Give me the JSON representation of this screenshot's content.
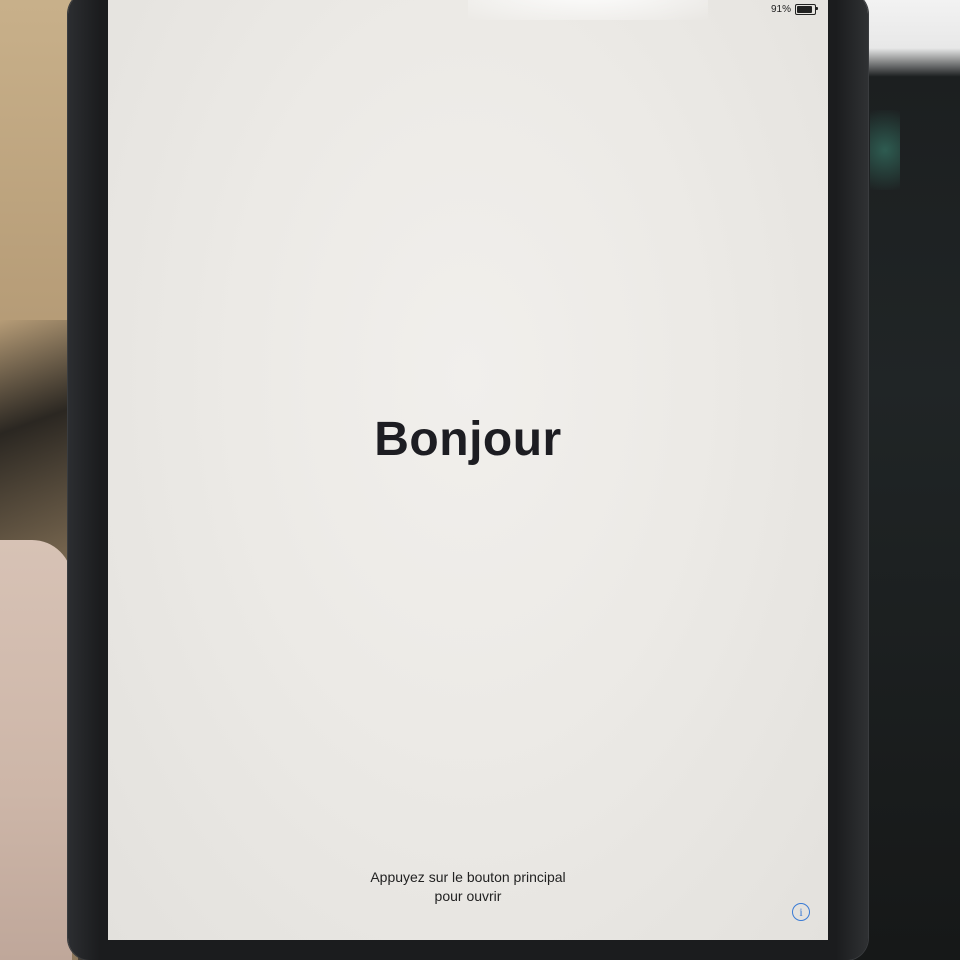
{
  "status_bar": {
    "battery_text": "91%",
    "battery_level": 0.91
  },
  "setup_screen": {
    "title": "Bonjour",
    "prompt_line1": "Appuyez sur le bouton principal",
    "prompt_line2": "pour ouvrir",
    "info_glyph": "i",
    "info_icon": "info-circle-icon"
  },
  "colors": {
    "accent": "#3a7bd5",
    "screen_background": "#ecebe7",
    "text": "#1d1d22"
  }
}
